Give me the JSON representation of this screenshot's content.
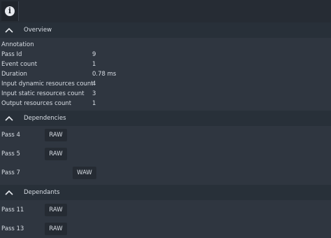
{
  "toolbar": {
    "info_icon_glyph": "i"
  },
  "overview": {
    "title": "Overview",
    "annotation_label": "Annotation",
    "rows": [
      {
        "label": "Pass Id",
        "value": "9"
      },
      {
        "label": "Event count",
        "value": "1"
      },
      {
        "label": "Duration",
        "value": "0.78 ms"
      },
      {
        "label": "Input dynamic resources count",
        "value": "4"
      },
      {
        "label": "Input static resources count",
        "value": "3"
      },
      {
        "label": "Output resources count",
        "value": "1"
      }
    ]
  },
  "dependencies": {
    "title": "Dependencies",
    "items": [
      {
        "label": "Pass 4",
        "tag": "RAW"
      },
      {
        "label": "Pass 5",
        "tag": "RAW"
      },
      {
        "label": "Pass 7",
        "tag": "WAW"
      }
    ]
  },
  "dependants": {
    "title": "Dependants",
    "items": [
      {
        "label": "Pass 11",
        "tag": "RAW"
      },
      {
        "label": "Pass 13",
        "tag": "RAW"
      }
    ]
  }
}
